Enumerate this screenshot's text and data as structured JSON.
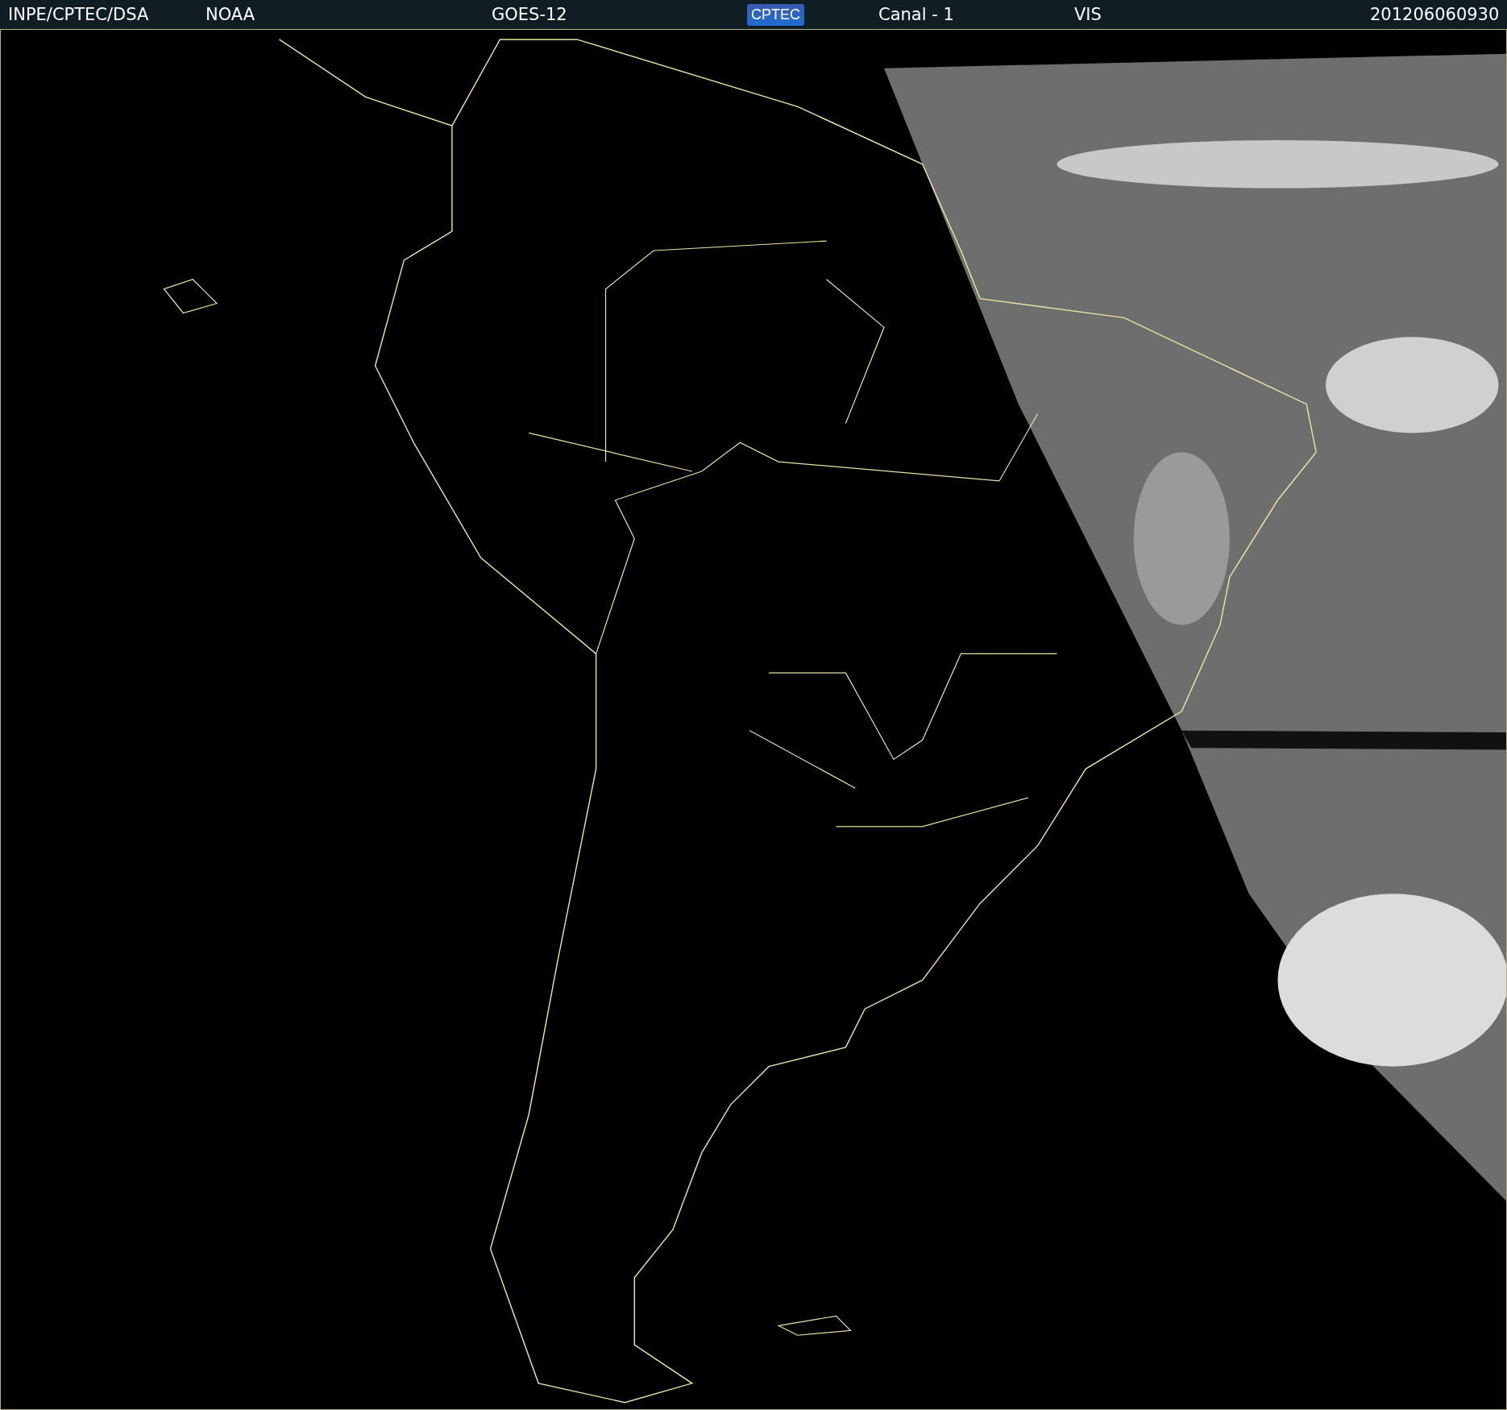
{
  "header": {
    "items": [
      {
        "kind": "text",
        "text": "INPE/CPTEC/DSA"
      },
      {
        "kind": "text",
        "text": "NOAA"
      },
      {
        "kind": "text",
        "text": "GOES-12"
      },
      {
        "kind": "logo",
        "text": "CPTEC"
      },
      {
        "kind": "text",
        "text": "Canal - 1"
      },
      {
        "kind": "text",
        "text": "VIS"
      },
      {
        "kind": "text",
        "text": "201206060930"
      }
    ]
  }
}
